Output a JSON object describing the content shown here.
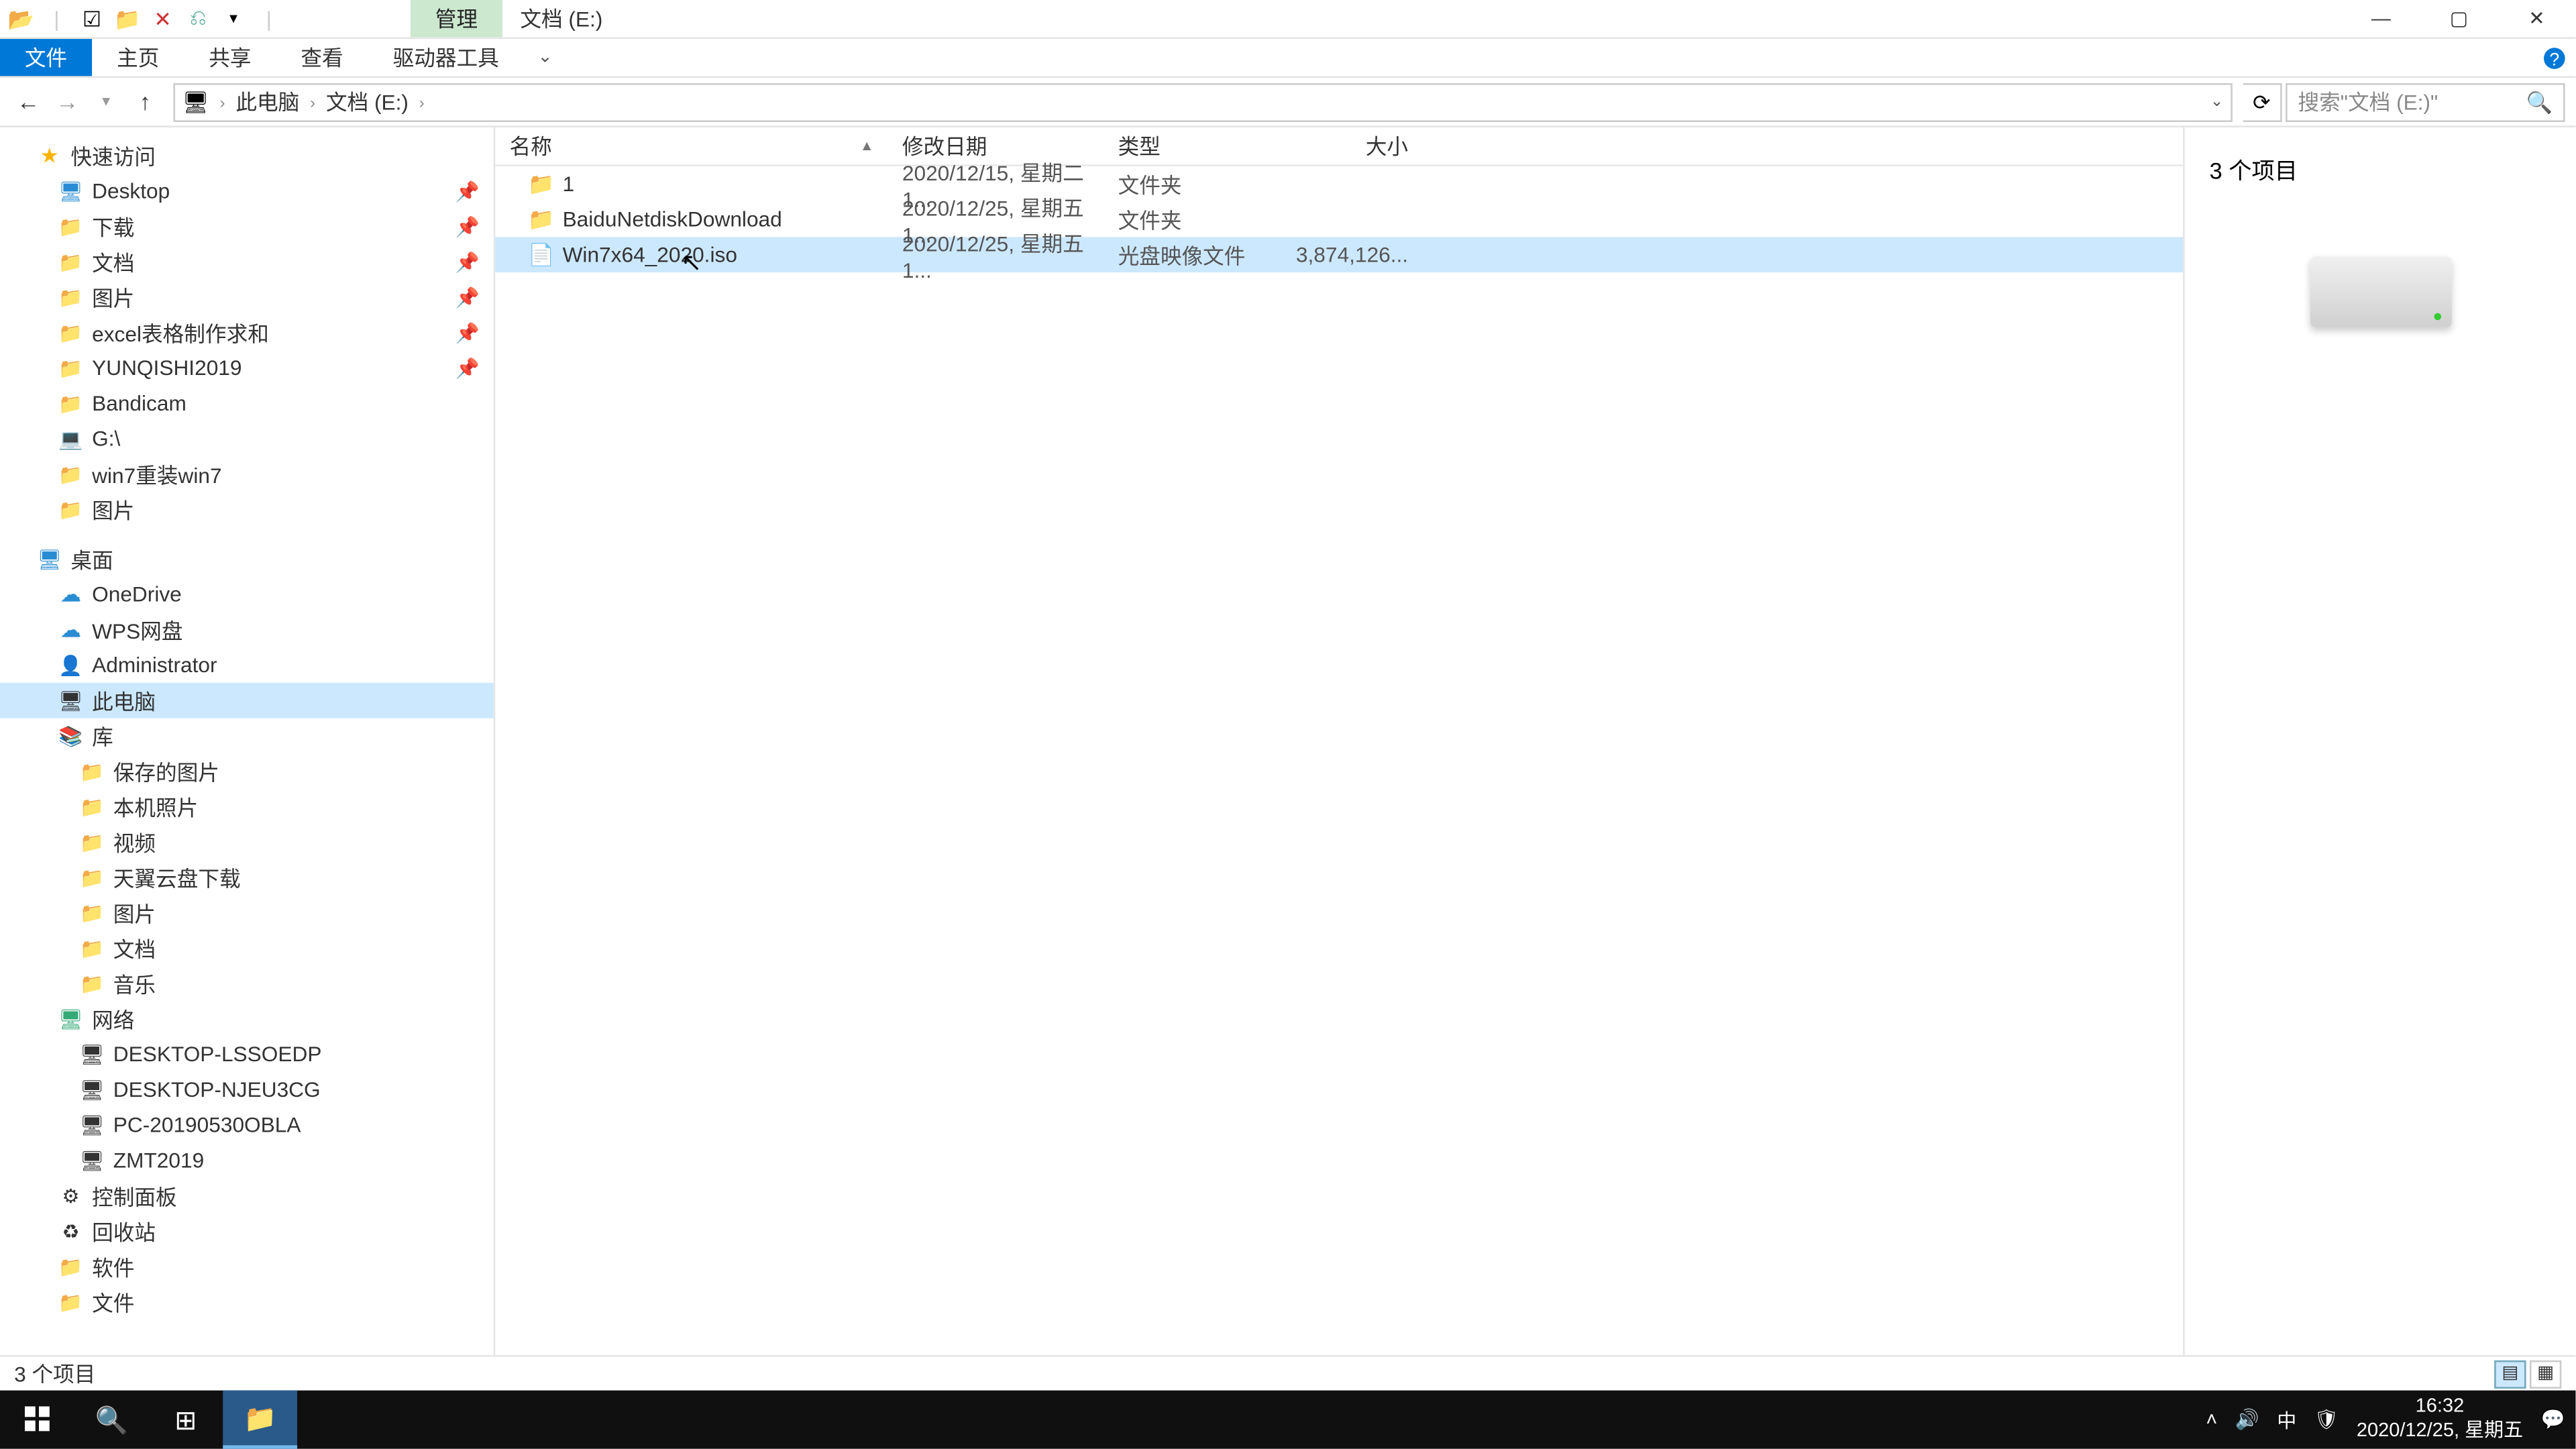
{
  "titlebar": {
    "context_tab": "管理",
    "title": "文档 (E:)"
  },
  "ribbon": {
    "file": "文件",
    "home": "主页",
    "share": "共享",
    "view": "查看",
    "drive_tools": "驱动器工具"
  },
  "address": {
    "crumb1": "此电脑",
    "crumb2": "文档 (E:)"
  },
  "search": {
    "placeholder": "搜索\"文档 (E:)\""
  },
  "columns": {
    "name": "名称",
    "date": "修改日期",
    "type": "类型",
    "size": "大小"
  },
  "rows": [
    {
      "name": "1",
      "date": "2020/12/15, 星期二 1...",
      "type": "文件夹",
      "size": "",
      "icon": "📁"
    },
    {
      "name": "BaiduNetdiskDownload",
      "date": "2020/12/25, 星期五 1...",
      "type": "文件夹",
      "size": "",
      "icon": "📁"
    },
    {
      "name": "Win7x64_2020.iso",
      "date": "2020/12/25, 星期五 1...",
      "type": "光盘映像文件",
      "size": "3,874,126...",
      "icon": "📄"
    }
  ],
  "nav": {
    "quick_access": "快速访问",
    "items_qa": [
      {
        "l": "Desktop",
        "i": "desk-ico",
        "pin": true
      },
      {
        "l": "下载",
        "i": "folder-ico",
        "pin": true
      },
      {
        "l": "文档",
        "i": "folder-ico",
        "pin": true
      },
      {
        "l": "图片",
        "i": "folder-ico",
        "pin": true
      },
      {
        "l": "excel表格制作求和",
        "i": "folder-ico",
        "pin": true
      },
      {
        "l": "YUNQISHI2019",
        "i": "folder-ico",
        "pin": true
      },
      {
        "l": "Bandicam",
        "i": "folder-ico",
        "pin": false
      },
      {
        "l": "G:\\",
        "i": "drive-ico",
        "pin": false
      },
      {
        "l": "win7重装win7",
        "i": "folder-ico",
        "pin": false
      },
      {
        "l": "图片",
        "i": "folder-ico",
        "pin": false
      }
    ],
    "desktop": "桌面",
    "items_desk": [
      {
        "l": "OneDrive",
        "i": "cloud-ico"
      },
      {
        "l": "WPS网盘",
        "i": "cloud-ico"
      },
      {
        "l": "Administrator",
        "i": "user-ico"
      },
      {
        "l": "此电脑",
        "i": "pc-ico",
        "sel": true
      },
      {
        "l": "库",
        "i": "lib-ico"
      },
      {
        "l": "保存的图片",
        "i": "folder-ico",
        "indent": true
      },
      {
        "l": "本机照片",
        "i": "folder-ico",
        "indent": true
      },
      {
        "l": "视频",
        "i": "folder-ico",
        "indent": true
      },
      {
        "l": "天翼云盘下载",
        "i": "folder-ico",
        "indent": true
      },
      {
        "l": "图片",
        "i": "folder-ico",
        "indent": true
      },
      {
        "l": "文档",
        "i": "folder-ico",
        "indent": true
      },
      {
        "l": "音乐",
        "i": "folder-ico",
        "indent": true
      },
      {
        "l": "网络",
        "i": "net-ico"
      },
      {
        "l": "DESKTOP-LSSOEDP",
        "i": "pc-ico",
        "indent": true
      },
      {
        "l": "DESKTOP-NJEU3CG",
        "i": "pc-ico",
        "indent": true
      },
      {
        "l": "PC-20190530OBLA",
        "i": "pc-ico",
        "indent": true
      },
      {
        "l": "ZMT2019",
        "i": "pc-ico",
        "indent": true
      },
      {
        "l": "控制面板",
        "i": "panel-ico"
      },
      {
        "l": "回收站",
        "i": "recy-ico"
      },
      {
        "l": "软件",
        "i": "folder-ico"
      },
      {
        "l": "文件",
        "i": "folder-ico"
      }
    ]
  },
  "details": {
    "count": "3 个项目"
  },
  "status": {
    "text": "3 个项目"
  },
  "tray": {
    "time": "16:32",
    "date": "2020/12/25, 星期五",
    "ime": "中"
  }
}
